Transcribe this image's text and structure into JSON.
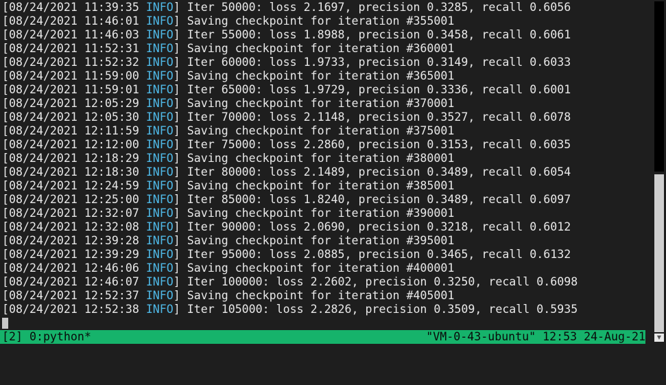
{
  "log_lines": [
    {
      "time": "[08/24/2021 11:39:35",
      "level": "INFO",
      "msg": "] Iter 50000: loss 2.1697, precision 0.3285, recall 0.6056"
    },
    {
      "time": "[08/24/2021 11:46:01",
      "level": "INFO",
      "msg": "] Saving checkpoint for iteration #355001"
    },
    {
      "time": "[08/24/2021 11:46:03",
      "level": "INFO",
      "msg": "] Iter 55000: loss 1.8988, precision 0.3458, recall 0.6061"
    },
    {
      "time": "[08/24/2021 11:52:31",
      "level": "INFO",
      "msg": "] Saving checkpoint for iteration #360001"
    },
    {
      "time": "[08/24/2021 11:52:32",
      "level": "INFO",
      "msg": "] Iter 60000: loss 1.9733, precision 0.3149, recall 0.6033"
    },
    {
      "time": "[08/24/2021 11:59:00",
      "level": "INFO",
      "msg": "] Saving checkpoint for iteration #365001"
    },
    {
      "time": "[08/24/2021 11:59:01",
      "level": "INFO",
      "msg": "] Iter 65000: loss 1.9729, precision 0.3336, recall 0.6001"
    },
    {
      "time": "[08/24/2021 12:05:29",
      "level": "INFO",
      "msg": "] Saving checkpoint for iteration #370001"
    },
    {
      "time": "[08/24/2021 12:05:30",
      "level": "INFO",
      "msg": "] Iter 70000: loss 2.1148, precision 0.3527, recall 0.6078"
    },
    {
      "time": "[08/24/2021 12:11:59",
      "level": "INFO",
      "msg": "] Saving checkpoint for iteration #375001"
    },
    {
      "time": "[08/24/2021 12:12:00",
      "level": "INFO",
      "msg": "] Iter 75000: loss 2.2860, precision 0.3153, recall 0.6035"
    },
    {
      "time": "[08/24/2021 12:18:29",
      "level": "INFO",
      "msg": "] Saving checkpoint for iteration #380001"
    },
    {
      "time": "[08/24/2021 12:18:30",
      "level": "INFO",
      "msg": "] Iter 80000: loss 2.1489, precision 0.3489, recall 0.6054"
    },
    {
      "time": "[08/24/2021 12:24:59",
      "level": "INFO",
      "msg": "] Saving checkpoint for iteration #385001"
    },
    {
      "time": "[08/24/2021 12:25:00",
      "level": "INFO",
      "msg": "] Iter 85000: loss 1.8240, precision 0.3489, recall 0.6097"
    },
    {
      "time": "[08/24/2021 12:32:07",
      "level": "INFO",
      "msg": "] Saving checkpoint for iteration #390001"
    },
    {
      "time": "[08/24/2021 12:32:08",
      "level": "INFO",
      "msg": "] Iter 90000: loss 2.0690, precision 0.3218, recall 0.6012"
    },
    {
      "time": "[08/24/2021 12:39:28",
      "level": "INFO",
      "msg": "] Saving checkpoint for iteration #395001"
    },
    {
      "time": "[08/24/2021 12:39:29",
      "level": "INFO",
      "msg": "] Iter 95000: loss 2.0885, precision 0.3465, recall 0.6132"
    },
    {
      "time": "[08/24/2021 12:46:06",
      "level": "INFO",
      "msg": "] Saving checkpoint for iteration #400001"
    },
    {
      "time": "[08/24/2021 12:46:07",
      "level": "INFO",
      "msg": "] Iter 100000: loss 2.2602, precision 0.3250, recall 0.6098"
    },
    {
      "time": "[08/24/2021 12:52:37",
      "level": "INFO",
      "msg": "] Saving checkpoint for iteration #405001"
    },
    {
      "time": "[08/24/2021 12:52:38",
      "level": "INFO",
      "msg": "] Iter 105000: loss 2.2826, precision 0.3509, recall 0.5935"
    }
  ],
  "status_bar": {
    "left": "[2] 0:python*",
    "right": "\"VM-0-43-ubuntu\" 12:53 24-Aug-21"
  },
  "colors": {
    "background": "#1e1e1e",
    "text": "#e8e8e8",
    "info_level": "#4fb8e6",
    "status_bar": "#16b36b"
  },
  "icons": {
    "scroll_up": "scroll-up-arrow-icon",
    "scroll_down": "scroll-down-arrow-icon"
  }
}
